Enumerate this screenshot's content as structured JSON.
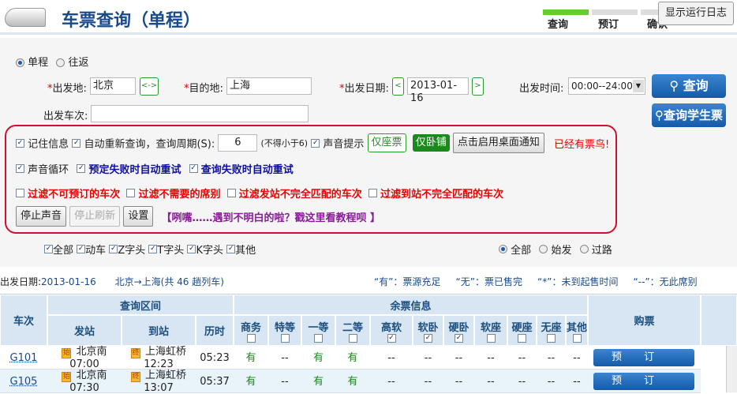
{
  "header": {
    "title": "车票查询（单程）",
    "steps": [
      "查询",
      "预订",
      "确认"
    ],
    "active_step": 0,
    "log_button": "显示运行日志"
  },
  "form": {
    "trip_types": [
      "单程",
      "往返"
    ],
    "trip_selected": "单程",
    "from_label": "出发地:",
    "from_value": "北京",
    "swap": "<->",
    "to_label": "目的地:",
    "to_value": "上海",
    "date_label": "出发日期:",
    "date_prev": "<",
    "date_value": "2013-01-16",
    "date_next": ">",
    "time_label": "出发时间:",
    "time_value": "00:00--24:00",
    "train_label": "出发车次:",
    "train_value": "",
    "query_button": "查询",
    "student_button": "查询学生票"
  },
  "options": {
    "remember": "记住信息",
    "auto_requery": "自动重新查询，查询周期(S):",
    "period": "6",
    "period_hint": "(不得小于6)",
    "sound": "声音提示",
    "seat_only": "仅座票",
    "sleeper_only": "仅卧铺",
    "desktop_notify": "点击启用桌面通知",
    "status": "已经有票鸟!",
    "sound_loop": "声音循环",
    "retry_book": "预定失败时自动重试",
    "retry_query": "查询失败时自动重试",
    "filters": [
      "过滤不可预订的车次",
      "过滤不需要的席别",
      "过滤发站不完全匹配的车次",
      "过滤到站不完全匹配的车次"
    ],
    "stop_sound": "停止声音",
    "stop_refresh": "停止刷新",
    "settings": "设置",
    "tutorial": "【咧嘴……遇到不明白的啦？戳这里看教程呗 】"
  },
  "train_types": [
    "全部",
    "动车",
    "Z字头",
    "T字头",
    "K字头",
    "其他"
  ],
  "station_types": [
    "全部",
    "始发",
    "过路"
  ],
  "station_selected": "全部",
  "summary": {
    "date_label": "出发日期:",
    "date": "2013-01-16",
    "route": "北京→上海(共 46 趟列车)",
    "legend": [
      "“有”：票源充足",
      "“无”：票已售完",
      "“*”：未到起售时间",
      "“--”：无此席别"
    ]
  },
  "table": {
    "train_col": "车次",
    "range_group": "查询区间",
    "ticket_group": "余票信息",
    "buy_col": "购票",
    "range_cols": [
      "发站",
      "到站",
      "历时"
    ],
    "seat_cols": [
      "商务",
      "特等",
      "一等",
      "二等",
      "高软",
      "软卧",
      "硬卧",
      "软座",
      "硬座",
      "无座",
      "其他"
    ],
    "seat_checked": [
      false,
      false,
      false,
      false,
      true,
      true,
      true,
      false,
      false,
      false,
      false
    ],
    "start_tag": "始",
    "end_tag": "终",
    "book_label": "预订",
    "rows": [
      {
        "train": "G101",
        "from": "北京南",
        "dep": "07:00",
        "to": "上海虹桥",
        "arr": "12:23",
        "duration": "05:23",
        "seats": [
          "有",
          "--",
          "有",
          "有",
          "--",
          "--",
          "--",
          "--",
          "--",
          "--",
          "--"
        ]
      },
      {
        "train": "G105",
        "from": "北京南",
        "dep": "07:30",
        "to": "上海虹桥",
        "arr": "13:07",
        "duration": "05:37",
        "seats": [
          "有",
          "--",
          "有",
          "有",
          "--",
          "--",
          "--",
          "--",
          "--",
          "--",
          "--"
        ]
      }
    ]
  },
  "colors": {
    "accent": "#1a5db0",
    "green": "#2a8a2a",
    "red": "#d0102a"
  }
}
